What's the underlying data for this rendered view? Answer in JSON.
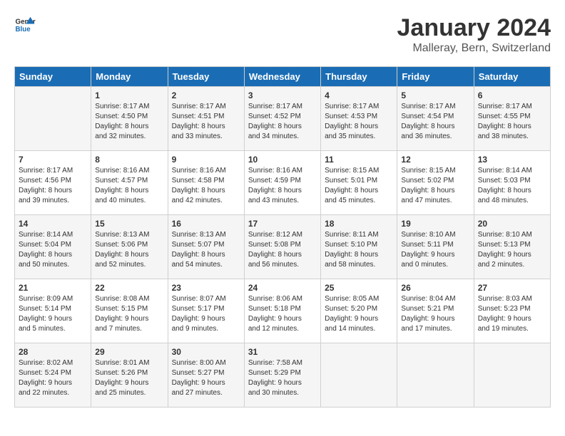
{
  "logo": {
    "line1": "General",
    "line2": "Blue"
  },
  "title": "January 2024",
  "subtitle": "Malleray, Bern, Switzerland",
  "weekdays": [
    "Sunday",
    "Monday",
    "Tuesday",
    "Wednesday",
    "Thursday",
    "Friday",
    "Saturday"
  ],
  "weeks": [
    [
      {
        "day": "",
        "info": ""
      },
      {
        "day": "1",
        "info": "Sunrise: 8:17 AM\nSunset: 4:50 PM\nDaylight: 8 hours\nand 32 minutes."
      },
      {
        "day": "2",
        "info": "Sunrise: 8:17 AM\nSunset: 4:51 PM\nDaylight: 8 hours\nand 33 minutes."
      },
      {
        "day": "3",
        "info": "Sunrise: 8:17 AM\nSunset: 4:52 PM\nDaylight: 8 hours\nand 34 minutes."
      },
      {
        "day": "4",
        "info": "Sunrise: 8:17 AM\nSunset: 4:53 PM\nDaylight: 8 hours\nand 35 minutes."
      },
      {
        "day": "5",
        "info": "Sunrise: 8:17 AM\nSunset: 4:54 PM\nDaylight: 8 hours\nand 36 minutes."
      },
      {
        "day": "6",
        "info": "Sunrise: 8:17 AM\nSunset: 4:55 PM\nDaylight: 8 hours\nand 38 minutes."
      }
    ],
    [
      {
        "day": "7",
        "info": "Sunrise: 8:17 AM\nSunset: 4:56 PM\nDaylight: 8 hours\nand 39 minutes."
      },
      {
        "day": "8",
        "info": "Sunrise: 8:16 AM\nSunset: 4:57 PM\nDaylight: 8 hours\nand 40 minutes."
      },
      {
        "day": "9",
        "info": "Sunrise: 8:16 AM\nSunset: 4:58 PM\nDaylight: 8 hours\nand 42 minutes."
      },
      {
        "day": "10",
        "info": "Sunrise: 8:16 AM\nSunset: 4:59 PM\nDaylight: 8 hours\nand 43 minutes."
      },
      {
        "day": "11",
        "info": "Sunrise: 8:15 AM\nSunset: 5:01 PM\nDaylight: 8 hours\nand 45 minutes."
      },
      {
        "day": "12",
        "info": "Sunrise: 8:15 AM\nSunset: 5:02 PM\nDaylight: 8 hours\nand 47 minutes."
      },
      {
        "day": "13",
        "info": "Sunrise: 8:14 AM\nSunset: 5:03 PM\nDaylight: 8 hours\nand 48 minutes."
      }
    ],
    [
      {
        "day": "14",
        "info": "Sunrise: 8:14 AM\nSunset: 5:04 PM\nDaylight: 8 hours\nand 50 minutes."
      },
      {
        "day": "15",
        "info": "Sunrise: 8:13 AM\nSunset: 5:06 PM\nDaylight: 8 hours\nand 52 minutes."
      },
      {
        "day": "16",
        "info": "Sunrise: 8:13 AM\nSunset: 5:07 PM\nDaylight: 8 hours\nand 54 minutes."
      },
      {
        "day": "17",
        "info": "Sunrise: 8:12 AM\nSunset: 5:08 PM\nDaylight: 8 hours\nand 56 minutes."
      },
      {
        "day": "18",
        "info": "Sunrise: 8:11 AM\nSunset: 5:10 PM\nDaylight: 8 hours\nand 58 minutes."
      },
      {
        "day": "19",
        "info": "Sunrise: 8:10 AM\nSunset: 5:11 PM\nDaylight: 9 hours\nand 0 minutes."
      },
      {
        "day": "20",
        "info": "Sunrise: 8:10 AM\nSunset: 5:13 PM\nDaylight: 9 hours\nand 2 minutes."
      }
    ],
    [
      {
        "day": "21",
        "info": "Sunrise: 8:09 AM\nSunset: 5:14 PM\nDaylight: 9 hours\nand 5 minutes."
      },
      {
        "day": "22",
        "info": "Sunrise: 8:08 AM\nSunset: 5:15 PM\nDaylight: 9 hours\nand 7 minutes."
      },
      {
        "day": "23",
        "info": "Sunrise: 8:07 AM\nSunset: 5:17 PM\nDaylight: 9 hours\nand 9 minutes."
      },
      {
        "day": "24",
        "info": "Sunrise: 8:06 AM\nSunset: 5:18 PM\nDaylight: 9 hours\nand 12 minutes."
      },
      {
        "day": "25",
        "info": "Sunrise: 8:05 AM\nSunset: 5:20 PM\nDaylight: 9 hours\nand 14 minutes."
      },
      {
        "day": "26",
        "info": "Sunrise: 8:04 AM\nSunset: 5:21 PM\nDaylight: 9 hours\nand 17 minutes."
      },
      {
        "day": "27",
        "info": "Sunrise: 8:03 AM\nSunset: 5:23 PM\nDaylight: 9 hours\nand 19 minutes."
      }
    ],
    [
      {
        "day": "28",
        "info": "Sunrise: 8:02 AM\nSunset: 5:24 PM\nDaylight: 9 hours\nand 22 minutes."
      },
      {
        "day": "29",
        "info": "Sunrise: 8:01 AM\nSunset: 5:26 PM\nDaylight: 9 hours\nand 25 minutes."
      },
      {
        "day": "30",
        "info": "Sunrise: 8:00 AM\nSunset: 5:27 PM\nDaylight: 9 hours\nand 27 minutes."
      },
      {
        "day": "31",
        "info": "Sunrise: 7:58 AM\nSunset: 5:29 PM\nDaylight: 9 hours\nand 30 minutes."
      },
      {
        "day": "",
        "info": ""
      },
      {
        "day": "",
        "info": ""
      },
      {
        "day": "",
        "info": ""
      }
    ]
  ]
}
